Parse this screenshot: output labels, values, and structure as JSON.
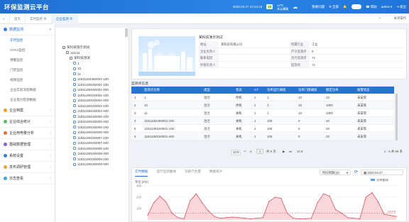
{
  "app": {
    "title": "环保监测云平台"
  },
  "topbar": {
    "datetime": "2020.03.27  10:13:18",
    "aqi": "18",
    "weather_temp": "15℃",
    "weather_desc": "多云轉晴",
    "bell_label": "我要问题",
    "tools_label": "全部",
    "help_label": "帮助",
    "user_label": "admin",
    "logout_label": "退出"
  },
  "tabs": [
    {
      "label": "首页"
    },
    {
      "label": "实时监控"
    },
    {
      "label": "企业监测"
    }
  ],
  "tabbar_right": "关闭操作",
  "sidebar": {
    "groups": [
      {
        "label": "数据监测",
        "icon": "monitor-icon",
        "color": "#3a7ad9",
        "expanded": true,
        "items": [
          "实时监控",
          "VOCs监控",
          "预警监控",
          "门禁监控",
          "视频监控",
          "企业实验流程数据",
          "企业电力检测数据"
        ]
      },
      {
        "label": "企业档案",
        "icon": "archive-icon",
        "color": "#f0a020"
      },
      {
        "label": "企业综合统计",
        "icon": "stats-icon",
        "color": "#5cb85c"
      },
      {
        "label": "企业用电量分析",
        "icon": "power-icon",
        "color": "#e96a3a"
      },
      {
        "label": "基础数据管理",
        "icon": "database-icon",
        "color": "#8a5ad9"
      },
      {
        "label": "系统设置",
        "icon": "gear-icon",
        "color": "#3a7ad9"
      },
      {
        "label": "发布调研管理",
        "icon": "survey-icon",
        "color": "#e9a33a"
      },
      {
        "label": "日志查看",
        "icon": "log-icon",
        "color": "#3aa9d9"
      }
    ]
  },
  "tree": {
    "nodes": [
      {
        "text": "某科技演示测试",
        "indent": 0,
        "kind": "box",
        "mark": "−"
      },
      {
        "text": "111111",
        "indent": 1,
        "kind": "box",
        "mark": "−"
      },
      {
        "text": "某科技测试",
        "indent": 2,
        "kind": "box",
        "mark": "−"
      },
      {
        "text": "1",
        "indent": 3,
        "kind": "doc"
      },
      {
        "text": "10",
        "indent": 3,
        "kind": "doc"
      },
      {
        "text": "11",
        "indent": 3,
        "kind": "doc"
      },
      {
        "text": "11911182450001-100",
        "indent": 3,
        "kind": "doc"
      },
      {
        "text": "11911190150001-100",
        "indent": 3,
        "kind": "doc"
      },
      {
        "text": "11911190150001-400",
        "indent": 3,
        "kind": "doc"
      },
      {
        "text": "11911190150002-100",
        "indent": 3,
        "kind": "doc"
      },
      {
        "text": "11911190150002-400",
        "indent": 3,
        "kind": "doc"
      },
      {
        "text": "11911190150004-100",
        "indent": 3,
        "kind": "doc"
      },
      {
        "text": "11911190150004-400",
        "indent": 3,
        "kind": "doc"
      },
      {
        "text": "11911190150005-100",
        "indent": 3,
        "kind": "doc"
      },
      {
        "text": "11911190150005-400",
        "indent": 3,
        "kind": "doc"
      },
      {
        "text": "11911190150006-100",
        "indent": 3,
        "kind": "doc"
      },
      {
        "text": "11911190150006-400",
        "indent": 3,
        "kind": "doc"
      },
      {
        "text": "11911190150007-100",
        "indent": 3,
        "kind": "doc"
      },
      {
        "text": "11911190150007-400",
        "indent": 3,
        "kind": "doc"
      },
      {
        "text": "11911190150008-100",
        "indent": 3,
        "kind": "doc"
      },
      {
        "text": "11911190150008-400",
        "indent": 3,
        "kind": "doc"
      },
      {
        "text": "11911190150009-100",
        "indent": 3,
        "kind": "doc"
      },
      {
        "text": "11911190150009-400",
        "indent": 3,
        "kind": "doc"
      }
    ]
  },
  "company": {
    "title": "某科技演示测试",
    "fields": [
      {
        "k": "地址",
        "v": "某科技有限公司",
        "k2": "所属行业",
        "v2": "工业"
      },
      {
        "k": "企业负责人",
        "v": "",
        "k2": "产污监测点",
        "v2": "9"
      },
      {
        "k": "联系电话",
        "v": "",
        "k2": "治污监测点",
        "v2": "74"
      },
      {
        "k": "环保负责人",
        "v": "",
        "k2": "监测点",
        "v2": "74"
      }
    ]
  },
  "monitor_section_title": "监测点信息",
  "table": {
    "headers": [
      "",
      "监测点名称",
      "类型",
      "状态",
      "CT",
      "功率运行阈值",
      "功率门限阈值",
      "额定功率",
      "报警状态"
    ],
    "rows": [
      [
        "1",
        "1",
        "治污",
        "停机",
        "1",
        "1",
        "10",
        "10",
        "未安装"
      ],
      [
        "2",
        "10",
        "治污",
        "停机",
        "1",
        "1",
        "10",
        "1000",
        "未安装"
      ],
      [
        "3",
        "11",
        "治污",
        "关机",
        "1",
        "1",
        "10",
        "1000",
        "未安装"
      ],
      [
        "4",
        "11911182450001-100",
        "治污",
        "关机",
        "1",
        "100",
        "0",
        "10",
        "未安装"
      ],
      [
        "5",
        "11911190150001-100",
        "治污",
        "关机",
        "1",
        "100",
        "0",
        "20",
        "未安装"
      ],
      [
        "6",
        "11911190150001-400",
        "治污",
        "关机",
        "1",
        "100",
        "0",
        "20",
        "未安装"
      ]
    ]
  },
  "pager": {
    "page_size": "10",
    "current": "1",
    "total_pages": "共 9 页",
    "per_page": "10",
    "summary": "1 - 6 共 69 条"
  },
  "chart_tabs": [
    "实时数据",
    "运行监测曲线",
    "功耗产生量",
    "数据统计"
  ],
  "chart_controls": {
    "range_label": "时间周期(分)",
    "date": "2020.03.27"
  },
  "chart_data": {
    "type": "area",
    "ylabel": "单位:(kW)",
    "yticks": [
      "300",
      "200",
      "100"
    ],
    "ylim": [
      0,
      300
    ],
    "legend": "功率曲线",
    "threshold_label": "22075",
    "values": [
      40,
      150,
      210,
      160,
      60,
      20,
      10,
      170,
      230,
      150,
      80,
      30,
      15,
      20,
      25,
      20,
      15,
      10,
      15,
      20,
      160,
      200,
      190,
      60,
      15,
      10,
      10,
      15,
      150,
      230,
      210,
      90,
      60,
      20,
      15,
      10,
      200,
      240,
      160,
      50,
      40,
      30
    ]
  }
}
